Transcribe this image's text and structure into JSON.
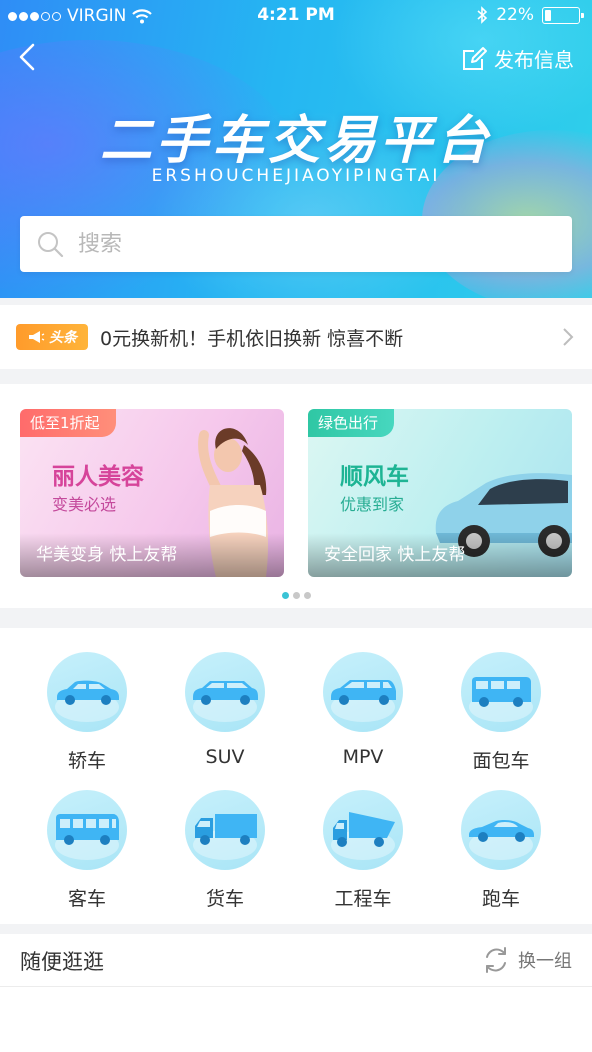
{
  "status_bar": {
    "carrier": "VIRGIN",
    "time": "4:21 PM",
    "battery": "22%"
  },
  "header": {
    "publish_label": "发布信息",
    "title": "二手车交易平台",
    "subtitle": "ERSHOUCHEJIAOYIPINGTAI"
  },
  "search": {
    "placeholder": "搜索"
  },
  "news": {
    "badge": "头条",
    "text": "0元换新机！手机依旧换新 惊喜不断"
  },
  "banners": [
    {
      "tag": "低至1折起",
      "title": "丽人美容",
      "subtitle": "变美必选",
      "footer": "华美变身 快上友帮"
    },
    {
      "tag": "绿色出行",
      "title": "顺风车",
      "subtitle": "优惠到家",
      "footer": "安全回家 快上友帮"
    }
  ],
  "categories": [
    {
      "label": "轿车",
      "icon": "sedan-icon"
    },
    {
      "label": "SUV",
      "icon": "suv-icon"
    },
    {
      "label": "MPV",
      "icon": "mpv-icon"
    },
    {
      "label": "面包车",
      "icon": "van-icon"
    },
    {
      "label": "客车",
      "icon": "bus-icon"
    },
    {
      "label": "货车",
      "icon": "truck-icon"
    },
    {
      "label": "工程车",
      "icon": "dump-truck-icon"
    },
    {
      "label": "跑车",
      "icon": "sports-car-icon"
    }
  ],
  "random": {
    "title": "随便逛逛",
    "refresh_label": "换一组"
  },
  "colors": {
    "accent": "#2fb6ef",
    "icon_blue": "#3fb5f4",
    "badge_orange": "#ff9b2b"
  }
}
